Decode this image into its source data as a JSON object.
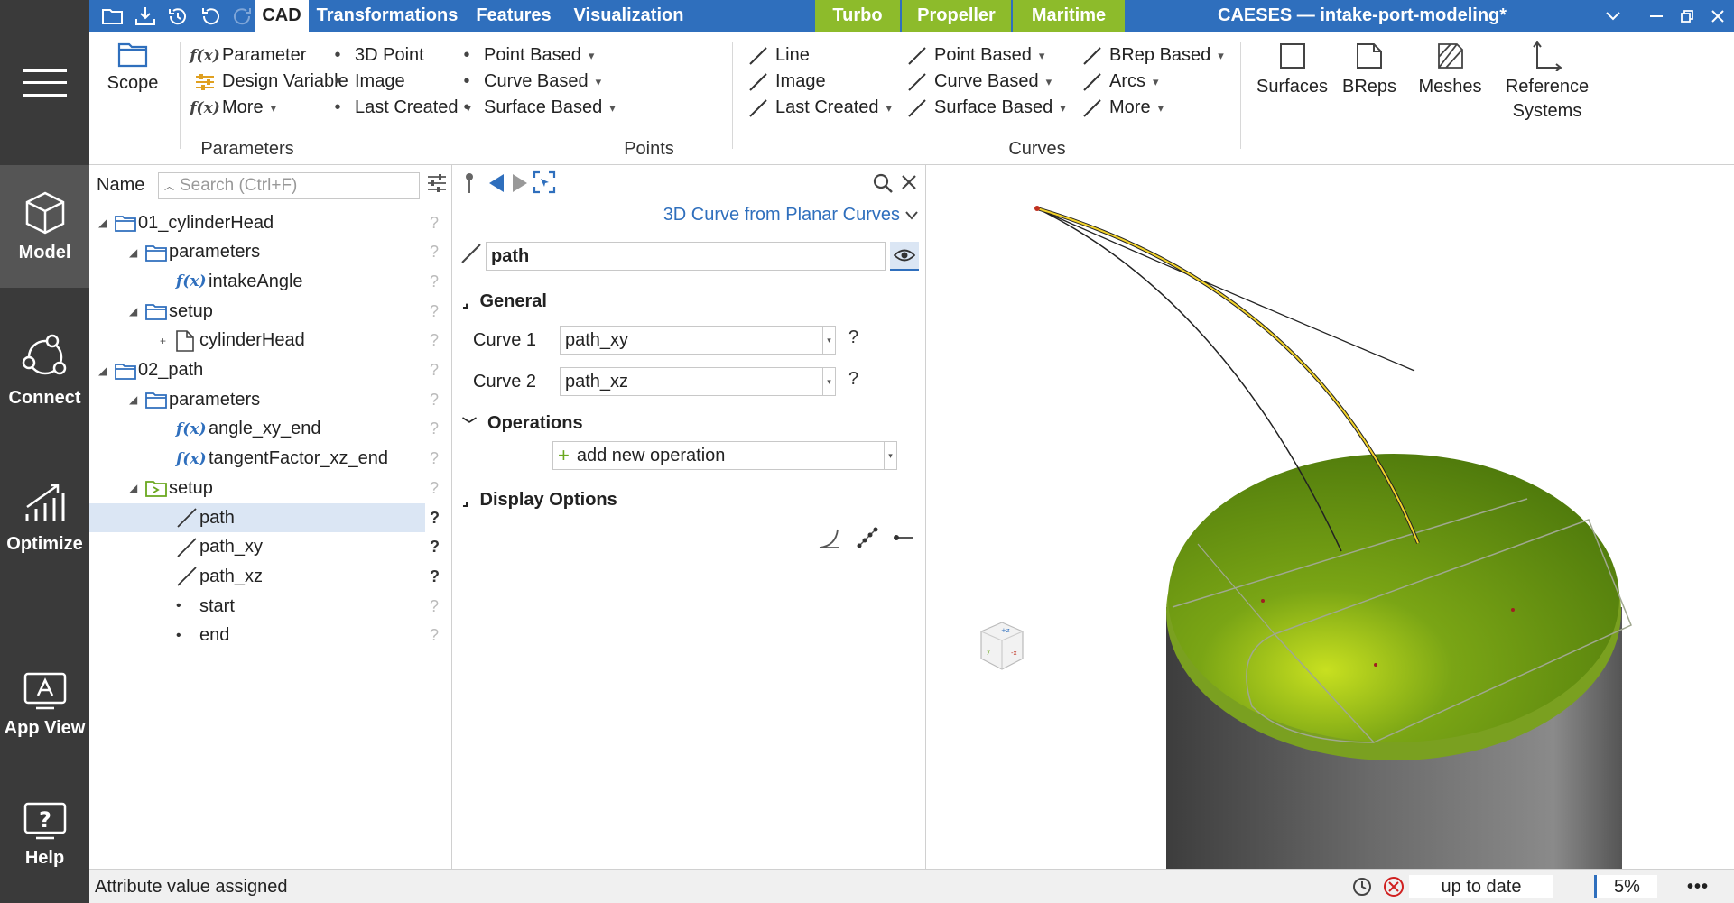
{
  "window": {
    "title": "CAESES — intake-port-modeling*"
  },
  "tabs": [
    {
      "label": "CAD",
      "active": true
    },
    {
      "label": "Transformations"
    },
    {
      "label": "Features"
    },
    {
      "label": "Visualization"
    },
    {
      "label": "Turbo",
      "green": true
    },
    {
      "label": "Propeller",
      "green": true
    },
    {
      "label": "Maritime",
      "green": true
    }
  ],
  "sidebar": {
    "items": [
      {
        "label": "Model",
        "active": true
      },
      {
        "label": "Connect"
      },
      {
        "label": "Optimize"
      },
      {
        "label": "App View"
      },
      {
        "label": "Help"
      }
    ]
  },
  "ribbon": {
    "scope_label": "Scope",
    "parameters": {
      "items": [
        "Parameter",
        "Design Variable",
        "More"
      ],
      "group_label": "Parameters"
    },
    "points": {
      "col1": [
        "3D Point",
        "Image",
        "Last Created"
      ],
      "col2": [
        "Point Based",
        "Curve Based",
        "Surface Based"
      ],
      "group_label": "Points"
    },
    "curves": {
      "col1": [
        "Line",
        "Image",
        "Last Created"
      ],
      "col2": [
        "Point Based",
        "Curve Based",
        "Surface Based"
      ],
      "col3": [
        "BRep Based",
        "Arcs",
        "More"
      ],
      "group_label": "Curves"
    },
    "big_buttons": [
      "Surfaces",
      "BReps",
      "Meshes",
      "Reference\nSystems"
    ]
  },
  "tree": {
    "header_label": "Name",
    "search_placeholder": "Search (Ctrl+F)",
    "rows": [
      {
        "label": "01_cylinderHead",
        "type": "folder",
        "level": 0,
        "toggle": "◢"
      },
      {
        "label": "parameters",
        "type": "folder",
        "level": 1,
        "toggle": "◢"
      },
      {
        "label": "intakeAngle",
        "type": "fx",
        "level": 2
      },
      {
        "label": "setup",
        "type": "folder",
        "level": 1,
        "toggle": "◢"
      },
      {
        "label": "cylinderHead",
        "type": "file",
        "level": 2,
        "toggle": "+"
      },
      {
        "label": "02_path",
        "type": "folder",
        "level": 0,
        "toggle": "◢"
      },
      {
        "label": "parameters",
        "type": "folder",
        "level": 1,
        "toggle": "◢"
      },
      {
        "label": "angle_xy_end",
        "type": "fx",
        "level": 2
      },
      {
        "label": "tangentFactor_xz_end",
        "type": "fx",
        "level": 2
      },
      {
        "label": "setup",
        "type": "folder-green",
        "level": 1,
        "toggle": "◢"
      },
      {
        "label": "path",
        "type": "curve",
        "level": 2,
        "selected": true
      },
      {
        "label": "path_xy",
        "type": "curve",
        "level": 2
      },
      {
        "label": "path_xz",
        "type": "curve",
        "level": 2
      },
      {
        "label": "start",
        "type": "point",
        "level": 2
      },
      {
        "label": "end",
        "type": "point",
        "level": 2
      }
    ]
  },
  "editor": {
    "type_label": "3D Curve from Planar Curves",
    "name_value": "path",
    "general_label": "General",
    "curve1_label": "Curve 1",
    "curve1_value": "path_xy",
    "curve2_label": "Curve 2",
    "curve2_value": "path_xz",
    "operations_label": "Operations",
    "add_operation_label": "add new operation",
    "display_options_label": "Display Options",
    "help_mark": "?"
  },
  "status": {
    "message": "Attribute value assigned",
    "state": "up to date",
    "percent": "5%"
  },
  "colors": {
    "accent_blue": "#2f6fbd",
    "green_tab": "#8dbb2b",
    "sidebar": "#3a3a3a",
    "cylinder_top": "#6a9a12",
    "cylinder_body": "#6e6e6e"
  }
}
